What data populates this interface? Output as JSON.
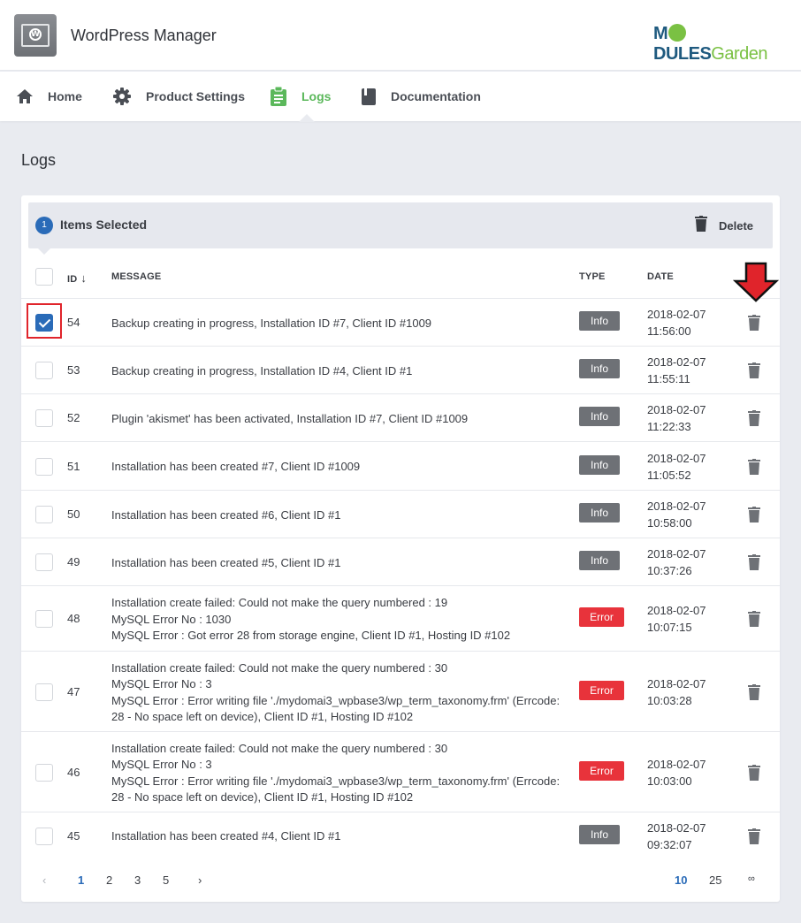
{
  "header": {
    "title": "WordPress Manager",
    "brand_left": "M",
    "brand_mid": "DULES",
    "brand_right": "Garden",
    "app_icon": "wordpress-window-icon"
  },
  "nav": [
    {
      "label": "Home",
      "icon": "home-icon",
      "active": false
    },
    {
      "label": "Product Settings",
      "icon": "gear-icon",
      "active": false
    },
    {
      "label": "Logs",
      "icon": "clipboard-icon",
      "active": true
    },
    {
      "label": "Documentation",
      "icon": "book-icon",
      "active": false
    }
  ],
  "page": {
    "title": "Logs"
  },
  "selection": {
    "count": "1",
    "label": "Items Selected",
    "delete_label": "Delete"
  },
  "table": {
    "headers": {
      "id": "ID",
      "sort_arrow": "↓",
      "message": "MESSAGE",
      "type": "TYPE",
      "date": "DATE"
    },
    "rows": [
      {
        "id": "54",
        "checked": true,
        "message": [
          "Backup creating in progress, Installation ID #7, Client ID #1009"
        ],
        "type": "Info",
        "date": "2018-02-07",
        "time": "11:56:00"
      },
      {
        "id": "53",
        "checked": false,
        "message": [
          "Backup creating in progress, Installation ID #4, Client ID #1"
        ],
        "type": "Info",
        "date": "2018-02-07",
        "time": "11:55:11"
      },
      {
        "id": "52",
        "checked": false,
        "message": [
          "Plugin 'akismet' has been activated, Installation ID #7, Client ID #1009"
        ],
        "type": "Info",
        "date": "2018-02-07",
        "time": "11:22:33"
      },
      {
        "id": "51",
        "checked": false,
        "message": [
          "Installation has been created #7, Client ID #1009"
        ],
        "type": "Info",
        "date": "2018-02-07",
        "time": "11:05:52"
      },
      {
        "id": "50",
        "checked": false,
        "message": [
          "Installation has been created #6, Client ID #1"
        ],
        "type": "Info",
        "date": "2018-02-07",
        "time": "10:58:00"
      },
      {
        "id": "49",
        "checked": false,
        "message": [
          "Installation has been created #5, Client ID #1"
        ],
        "type": "Info",
        "date": "2018-02-07",
        "time": "10:37:26"
      },
      {
        "id": "48",
        "checked": false,
        "message": [
          "Installation create failed: Could not make the query numbered : 19",
          "MySQL Error No : 1030",
          "MySQL Error : Got error 28 from storage engine, Client ID #1, Hosting ID #102"
        ],
        "type": "Error",
        "date": "2018-02-07",
        "time": "10:07:15"
      },
      {
        "id": "47",
        "checked": false,
        "message": [
          "Installation create failed: Could not make the query numbered : 30",
          "MySQL Error No : 3",
          "MySQL Error : Error writing file './mydomai3_wpbase3/wp_term_taxonomy.frm' (Errcode:",
          "28 - No space left on device), Client ID #1, Hosting ID #102"
        ],
        "type": "Error",
        "date": "2018-02-07",
        "time": "10:03:28"
      },
      {
        "id": "46",
        "checked": false,
        "message": [
          "Installation create failed: Could not make the query numbered : 30",
          "MySQL Error No : 3",
          "MySQL Error : Error writing file './mydomai3_wpbase3/wp_term_taxonomy.frm' (Errcode:",
          "28 - No space left on device), Client ID #1, Hosting ID #102"
        ],
        "type": "Error",
        "date": "2018-02-07",
        "time": "10:03:00"
      },
      {
        "id": "45",
        "checked": false,
        "message": [
          "Installation has been created #4, Client ID #1"
        ],
        "type": "Info",
        "date": "2018-02-07",
        "time": "09:32:07"
      }
    ]
  },
  "pagination": {
    "prev": "‹",
    "pages": [
      "1",
      "2",
      "3",
      "5"
    ],
    "current": "1",
    "next": "›",
    "per_page": [
      "10",
      "25",
      "∞"
    ],
    "per_page_current": "10"
  },
  "colors": {
    "accent": "#2a6bb8",
    "active_nav": "#5bb85b",
    "info_badge": "#6e7176",
    "error_badge": "#e8333b",
    "annotation": "#e0242b"
  }
}
